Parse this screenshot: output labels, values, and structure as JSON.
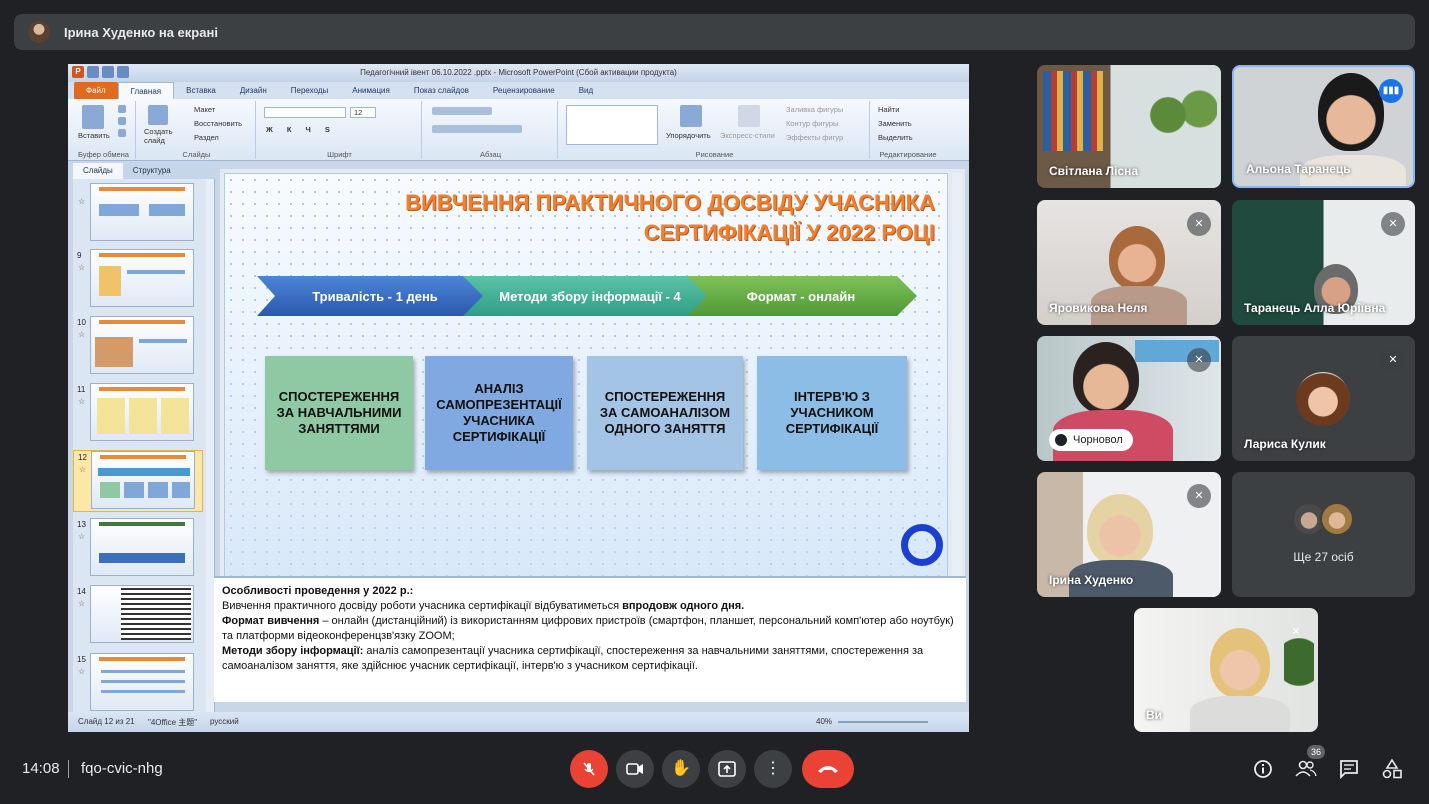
{
  "presenter_bar": {
    "text": "Ірина Худенко на екрані"
  },
  "powerpoint": {
    "window_title": "Педагогічний івент 06.10.2022 .pptx - Microsoft PowerPoint (Сбой активации продукта)",
    "tabs": [
      "Файл",
      "Главная",
      "Вставка",
      "Дизайн",
      "Переходы",
      "Анимация",
      "Показ слайдов",
      "Рецензирование",
      "Вид"
    ],
    "ribbon": {
      "clipboard_paste": "Вставить",
      "clipboard_label": "Буфер обмена",
      "create_slide": "Создать слайд",
      "layout": "Макет",
      "reset": "Восстановить",
      "section": "Раздел",
      "slides_label": "Слайды",
      "font_size": "12",
      "font_label": "Шрифт",
      "paragraph_label": "Абзац",
      "arrange": "Упорядочить",
      "express_styles": "Экспресс-стили",
      "fill": "Заливка фигуры",
      "outline": "Контур фигуры",
      "effects": "Эффекты фигур",
      "drawing_label": "Рисование",
      "find": "Найти",
      "replace": "Заменить",
      "select": "Выделить",
      "editing_label": "Редактирование"
    },
    "left_tabs": [
      "Слайды",
      "Структура"
    ],
    "thumb_numbers": [
      "9",
      "10",
      "11",
      "12",
      "13",
      "14",
      "15"
    ],
    "slide": {
      "title_line1": "ВИВЧЕННЯ ПРАКТИЧНОГО ДОСВІДУ УЧАСНИКА",
      "title_line2": "СЕРТИФІКАЦІЇ У 2022 РОЦІ",
      "chevrons": [
        "Тривалість - 1 день",
        "Методи збору інформації - 4",
        "Формат - онлайн"
      ],
      "boxes": [
        "СПОСТЕРЕЖЕННЯ ЗА НАВЧАЛЬНИМИ ЗАНЯТТЯМИ",
        "АНАЛІЗ САМОПРЕЗЕНТАЦІЇ УЧАСНИКА СЕРТИФІКАЦІЇ",
        "СПОСТЕРЕЖЕННЯ ЗА САМОАНАЛІЗОМ ОДНОГО ЗАНЯТТЯ",
        "ІНТЕРВ'Ю З УЧАСНИКОМ СЕРТИФІКАЦІЇ"
      ],
      "box_colors": [
        "#8fc9a4",
        "#7fa9e0",
        "#a4c4e6",
        "#8cbde6"
      ]
    },
    "notes": {
      "heading": "Особливості проведення у 2022 р.:",
      "line1_a": "Вивчення практичного досвіду роботи учасника сертифікації відбуватиметься ",
      "line1_b": "впродовж одного дня.",
      "line2_label": "Формат вивчення",
      "line2_text": "  – онлайн (дистанційний) із використанням цифрових пристроїв (смартфон, планшет, персональний комп'ютер або ноутбук) та платформи відеоконференцзв'язку  ZOOM;",
      "line3_label": "Методи збору інформації:",
      "line3_text": " аналіз самопрезентації учасника сертифікації, спостереження за навчальними заняттями, спостереження за самоаналізом заняття, яке здійснює  учасник сертифікації, інтерв'ю з учасником сертифікації."
    },
    "status": {
      "slide": "Слайд 12 из 21",
      "theme": "\"4Office 主题\"",
      "lang": "русский",
      "zoom": "40%"
    }
  },
  "participants": [
    {
      "name": "Світлана Лісна"
    },
    {
      "name": "Альона Таранець"
    },
    {
      "name": "Яровикова Неля"
    },
    {
      "name": "Таранець Алла Юріївна"
    },
    {
      "name": "Чорновол"
    },
    {
      "name": "Лариса Кулик"
    },
    {
      "name": "Ірина Худенко"
    },
    {
      "name": "Ще 27 осіб"
    },
    {
      "name": "Ви"
    }
  ],
  "bottom": {
    "time": "14:08",
    "meeting_code": "fqo-cvic-nhg",
    "participants_count": "36"
  }
}
